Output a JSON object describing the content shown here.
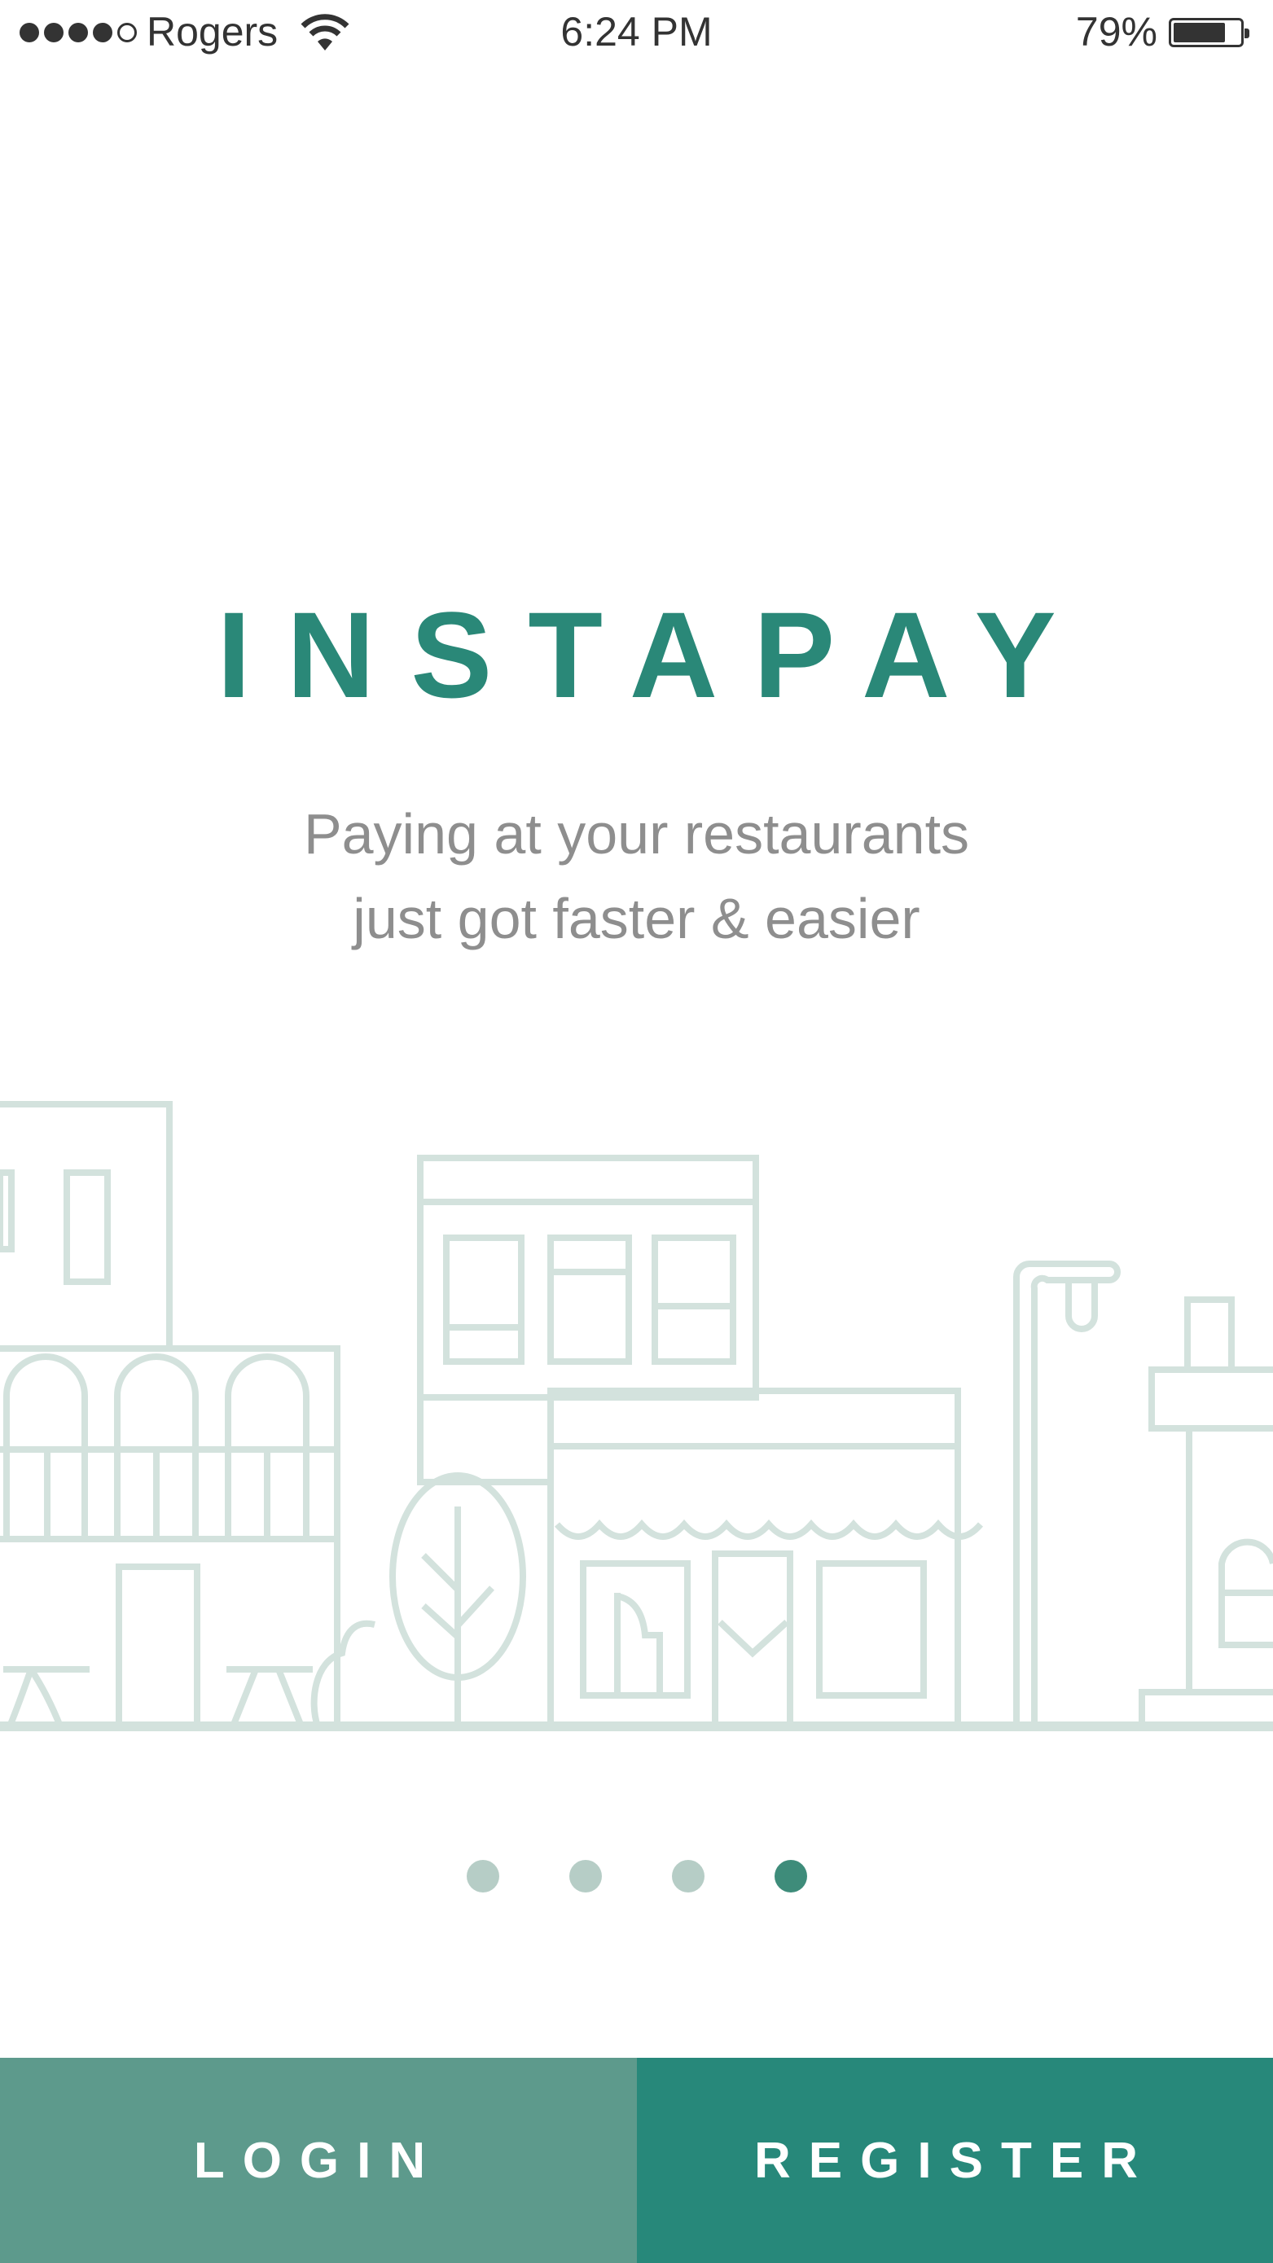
{
  "status_bar": {
    "carrier": "Rogers",
    "time": "6:24 PM",
    "battery_percent": "79%",
    "battery_level": 0.79,
    "signal_bars_filled": 4,
    "signal_bars_total": 5,
    "icons": [
      "signal-icon",
      "wifi-icon",
      "battery-icon"
    ]
  },
  "brand": {
    "title": "INSTAPAY",
    "color": "#2a8878"
  },
  "tagline": {
    "line1": "Paying at your restaurants",
    "line2": "just got faster & easier"
  },
  "illustration": {
    "name": "storefront-illustration",
    "stroke_color": "#d3e2dd"
  },
  "pager": {
    "total": 4,
    "active_index": 3
  },
  "actions": {
    "login_label": "LOGIN",
    "register_label": "REGISTER",
    "login_color": "#5d9a8c",
    "register_color": "#27887a"
  }
}
